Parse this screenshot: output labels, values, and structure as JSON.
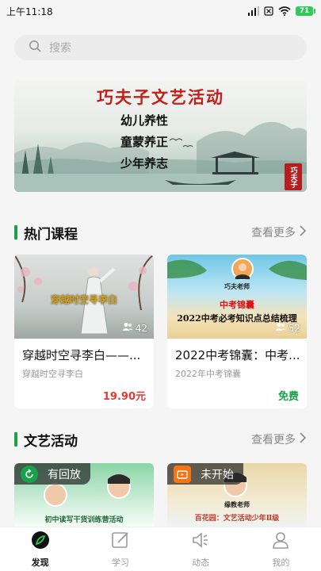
{
  "status_bar": {
    "time": "上午11:18",
    "battery": "71"
  },
  "search": {
    "placeholder": "搜索"
  },
  "banner": {
    "title": "巧夫子文艺活动",
    "lines": [
      "幼儿养性",
      "童蒙养正",
      "少年养志"
    ],
    "seal": "巧夫子"
  },
  "hot_courses": {
    "title": "热门课程",
    "more": "查看更多",
    "items": [
      {
        "thumb_caption": "穿越时空寻李白",
        "views": "42",
        "title": "穿越时空寻李白——...",
        "subtitle": "穿越时空寻李白",
        "price": "19.90元"
      },
      {
        "thumb_teacher": "巧夫老师",
        "thumb_caption_1": "中考锦囊",
        "thumb_caption_2": "2022中考必考知识点总结梳理",
        "views": "52",
        "title": "2022中考锦囊：中考...",
        "subtitle": "2022年中考锦囊",
        "price": "免费"
      }
    ]
  },
  "art_activities": {
    "title": "文艺活动",
    "more": "查看更多",
    "items": [
      {
        "badge": "有回放",
        "thumb_caption": "初中读写干货训练营活动"
      },
      {
        "badge": "未开始",
        "thumb_teacher": "缘教老师",
        "thumb_caption": "百花园：文艺活动少年Ⅱ级"
      }
    ]
  },
  "tabbar": {
    "tabs": [
      {
        "label": "发现",
        "active": true
      },
      {
        "label": "学习",
        "active": false
      },
      {
        "label": "动态",
        "active": false
      },
      {
        "label": "我的",
        "active": false
      }
    ]
  },
  "colors": {
    "accent": "#16a34a",
    "price": "#e53935",
    "banner_title": "#c42019"
  }
}
